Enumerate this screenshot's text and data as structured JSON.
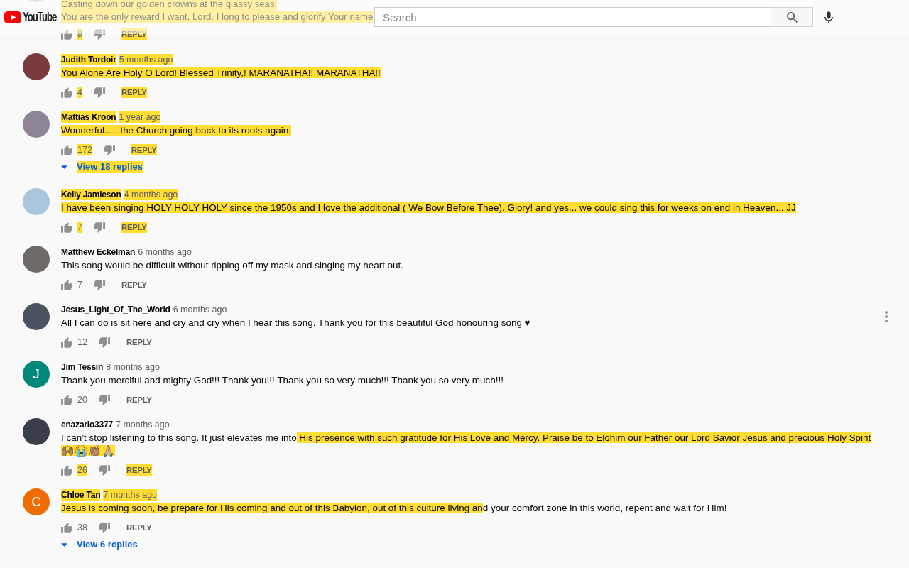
{
  "header": {
    "logo_text": "YouTube",
    "search": {
      "placeholder": "Search"
    }
  },
  "partial_comment": {
    "avatar": {
      "kind": "photo"
    },
    "lines": [
      {
        "text": "Casting down our golden crowns at the glassy seas;",
        "highlighted": true
      },
      {
        "text": "You are the only reward I want, Lord. I long to please and glorify Your name",
        "highlighted": true
      }
    ],
    "likes": {
      "text": "8",
      "highlighted": true
    },
    "reply": {
      "text": "REPLY",
      "highlighted": true
    }
  },
  "comments": [
    {
      "avatar": {
        "kind": "photo",
        "color": "#7a3b3e"
      },
      "author": {
        "text": "Judith Tordoir",
        "highlighted": true
      },
      "time": {
        "text": "5 months ago",
        "highlighted": true
      },
      "body": [
        {
          "text": "You Alone Are Holy O Lord! Blessed Trinity,! MARANATHA!! MARANATHA!!",
          "highlighted": true
        }
      ],
      "likes": {
        "text": "4",
        "highlighted": true
      },
      "reply": {
        "text": "REPLY",
        "highlighted": true
      },
      "menu_shown": false
    },
    {
      "avatar": {
        "kind": "photo",
        "color": "#8c8494"
      },
      "author": {
        "text": "Mattias Kroon",
        "highlighted": true
      },
      "time": {
        "text": "1 year ago",
        "highlighted": true
      },
      "body": [
        {
          "text": "Wonderful......the Church going back to its roots again.",
          "highlighted": true
        }
      ],
      "likes": {
        "text": "172",
        "highlighted": true
      },
      "reply": {
        "text": "REPLY",
        "highlighted": true
      },
      "replies_link": {
        "text": "View 18 replies",
        "highlighted": true
      },
      "menu_shown": false
    },
    {
      "avatar": {
        "kind": "photo",
        "color": "#a9c6dc"
      },
      "author": {
        "text": "Kelly Jamieson",
        "highlighted": true
      },
      "time": {
        "text": "4 months ago",
        "highlighted": true
      },
      "body": [
        {
          "text": "I have been singing HOLY HOLY HOLY since the 1950s and I love the additional ( We Bow Before Thee). Glory! and yes... we could sing this for weeks on end in Heaven... JJ",
          "highlighted": true
        }
      ],
      "likes": {
        "text": "7",
        "highlighted": true
      },
      "reply": {
        "text": "REPLY",
        "highlighted": true
      },
      "menu_shown": false
    },
    {
      "avatar": {
        "kind": "photo",
        "color": "#6d6a68"
      },
      "author": {
        "text": "Matthew Eckelman",
        "highlighted": false
      },
      "time": {
        "text": "6 months ago",
        "highlighted": false
      },
      "body": [
        {
          "text": "This song would be difficult without ripping off my mask and singing my heart out.",
          "highlighted": false
        }
      ],
      "likes": {
        "text": "7",
        "highlighted": false
      },
      "reply": {
        "text": "REPLY",
        "highlighted": false
      },
      "menu_shown": false
    },
    {
      "avatar": {
        "kind": "photo",
        "color": "#4b5262"
      },
      "author": {
        "text": "Jesus_Light_Of_The_World",
        "highlighted": false
      },
      "time": {
        "text": "6 months ago",
        "highlighted": false
      },
      "body": [
        {
          "text": "All I can do is sit here and cry and cry when I hear this song. Thank you for this beautiful God honouring song ♥",
          "highlighted": false
        }
      ],
      "likes": {
        "text": "12",
        "highlighted": false
      },
      "reply": {
        "text": "REPLY",
        "highlighted": false
      },
      "menu_shown": true
    },
    {
      "avatar": {
        "kind": "letter",
        "letter": "J",
        "color": "#00897b"
      },
      "author": {
        "text": "Jim Tessin",
        "highlighted": false
      },
      "time": {
        "text": "8 months ago",
        "highlighted": false
      },
      "body": [
        {
          "text": "Thank you merciful and mighty God!!! Thank you!!! Thank you so very much!!! Thank you so very much!!!",
          "highlighted": false
        }
      ],
      "likes": {
        "text": "20",
        "highlighted": false
      },
      "reply": {
        "text": "REPLY",
        "highlighted": false
      },
      "menu_shown": false
    },
    {
      "avatar": {
        "kind": "photo",
        "color": "#3a3e4a"
      },
      "author": {
        "text": "enazario3377",
        "highlighted": false
      },
      "time": {
        "text": "7 months ago",
        "highlighted": false
      },
      "body": [
        {
          "text": "I can’t stop listening to this song. It just elevates me into",
          "highlighted": false
        },
        {
          "text": " His presence with such gratitude for His Love and Mercy. Praise be to Elohim our Father our Lord Savior Jesus and precious Holy Spirit 🙌🏽😭👏🏽🙏🏼",
          "highlighted": true
        }
      ],
      "likes": {
        "text": "26",
        "highlighted": true
      },
      "reply": {
        "text": "REPLY",
        "highlighted": true
      },
      "menu_shown": false
    },
    {
      "avatar": {
        "kind": "letter",
        "letter": "C",
        "color": "#ef6c00"
      },
      "author": {
        "text": "Chloe Tan",
        "highlighted": true
      },
      "time": {
        "text": "7 months ago",
        "highlighted": true
      },
      "body": [
        {
          "text": "Jesus is coming soon, be prepare for His coming and out of this Babylon, out of this culture living an",
          "highlighted": true
        },
        {
          "text": "d your comfort zone in this world, repent and wait for Him!",
          "highlighted": false
        }
      ],
      "likes": {
        "text": "38",
        "highlighted": false
      },
      "reply": {
        "text": "REPLY",
        "highlighted": false
      },
      "replies_link": {
        "text": "View 6 replies",
        "highlighted": false
      },
      "menu_shown": false
    }
  ]
}
